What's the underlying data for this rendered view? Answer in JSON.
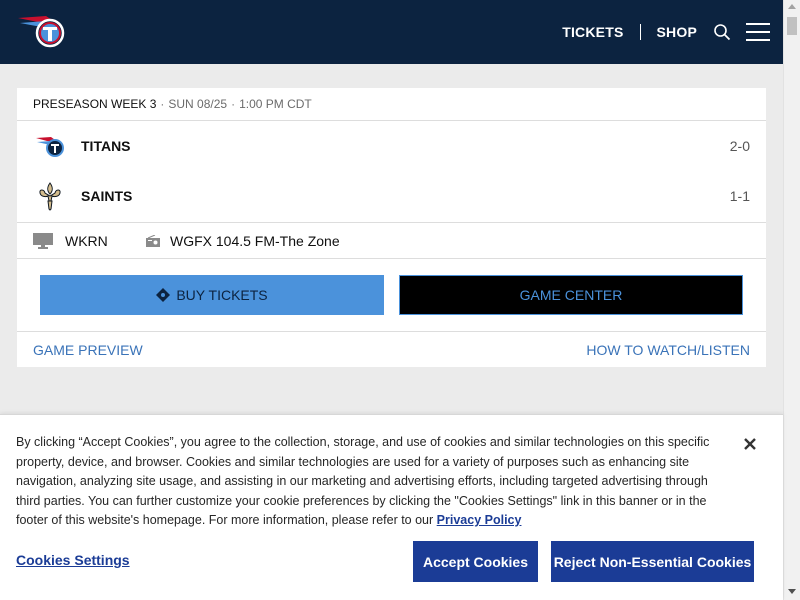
{
  "header": {
    "logo_icon": "titans-logo-icon",
    "nav": {
      "tickets": "TICKETS",
      "shop": "SHOP"
    },
    "search_icon": "search-icon",
    "menu_icon": "hamburger-menu-icon",
    "bg_color": "#0c2340"
  },
  "game": {
    "week": "PRESEASON WEEK 3",
    "date": "SUN 08/25",
    "time": "1:00 PM CDT",
    "teams": [
      {
        "name": "TITANS",
        "record": "2-0",
        "logo_icon": "titans-logo-icon"
      },
      {
        "name": "SAINTS",
        "record": "1-1",
        "logo_icon": "saints-logo-icon"
      }
    ],
    "broadcast": {
      "tv": "WKRN",
      "radio": "WGFX 104.5 FM-The Zone"
    },
    "buttons": {
      "buy_tickets": "BUY TICKETS",
      "game_center": "GAME CENTER"
    },
    "links": {
      "preview": "GAME PREVIEW",
      "watch": "HOW TO WATCH/LISTEN"
    }
  },
  "cookie_banner": {
    "text": "By clicking “Accept Cookies”, you agree to the collection, storage, and use of cookies and similar technologies on this specific property, device, and browser. Cookies and similar technologies are used for a variety of purposes such as enhancing site navigation, analyzing site usage, and assisting in our marketing and advertising efforts, including targeted advertising through third parties. You can further customize your cookie preferences by clicking the \"Cookies Settings\" link in this banner or in the footer of this website's homepage. For more information, please refer to our",
    "privacy_link": "Privacy Policy",
    "settings_link": "Cookies Settings",
    "accept": "Accept Cookies",
    "reject": "Reject Non-Essential Cookies",
    "accent_color": "#1b3c96"
  }
}
